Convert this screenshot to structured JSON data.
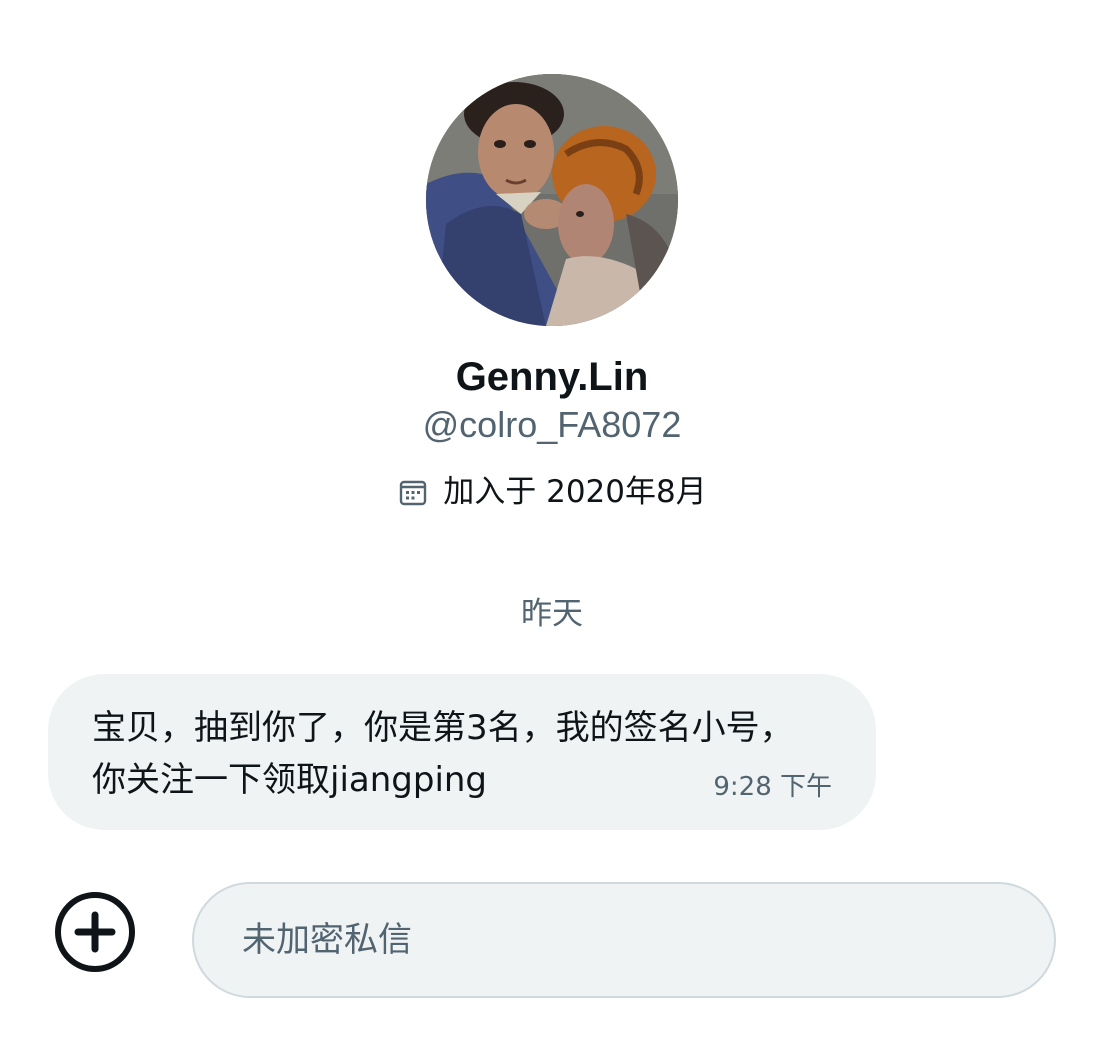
{
  "profile": {
    "display_name": "Genny.Lin",
    "handle": "@colro_FA8072",
    "joined_icon": "calendar-icon",
    "joined": "加入于 2020年8月"
  },
  "conversation": {
    "date_divider": "昨天",
    "messages": [
      {
        "text": "宝贝，抽到你了，你是第3名，我的签名小号，你关注一下领取jiangping",
        "time": "9:28 下午"
      }
    ]
  },
  "composer": {
    "add_icon": "plus-circle-icon",
    "placeholder": "未加密私信"
  },
  "colors": {
    "bubble_bg": "#eff3f4",
    "secondary_text": "#536471",
    "primary_text": "#0f1419"
  }
}
